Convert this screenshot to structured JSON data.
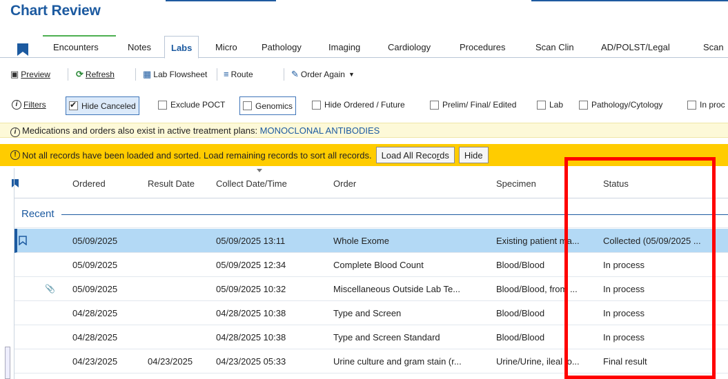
{
  "title": "Chart Review",
  "tabs": [
    {
      "label": "Encounters",
      "active": false
    },
    {
      "label": "Notes",
      "active": false
    },
    {
      "label": "Labs",
      "active": true
    },
    {
      "label": "Micro",
      "active": false
    },
    {
      "label": "Pathology",
      "active": false
    },
    {
      "label": "Imaging",
      "active": false
    },
    {
      "label": "Cardiology",
      "active": false
    },
    {
      "label": "Procedures",
      "active": false
    },
    {
      "label": "Scan Clin",
      "active": false
    },
    {
      "label": "AD/POLST/Legal",
      "active": false
    },
    {
      "label": "Scan",
      "active": false
    }
  ],
  "toolbar": {
    "preview": "Preview",
    "refresh": "Refresh",
    "flowsheet": "Lab Flowsheet",
    "route": "Route",
    "order_again": "Order Again"
  },
  "filters": {
    "label": "Filters",
    "items": [
      {
        "label": "Hide Canceled",
        "checked": true
      },
      {
        "label": "Exclude POCT",
        "checked": false
      },
      {
        "label": "Genomics",
        "checked": false
      },
      {
        "label": "Hide Ordered / Future",
        "checked": false
      },
      {
        "label": "Prelim/ Final/ Edited",
        "checked": false
      },
      {
        "label": "Lab",
        "checked": false
      },
      {
        "label": "Pathology/Cytology",
        "checked": false
      },
      {
        "label": "In proc",
        "checked": false
      }
    ]
  },
  "info": {
    "text": "Medications and orders also exist in active treatment plans: ",
    "link": "MONOCLONAL ANTIBODIES"
  },
  "warning": {
    "text": "Not all records have been loaded and sorted. Load remaining records to sort all records.",
    "load_all_prefix": "Load All Reco",
    "load_all_underline": "r",
    "load_all_suffix": "ds",
    "hide": "Hide"
  },
  "grid": {
    "columns": [
      "Ordered",
      "Result Date",
      "Collect Date/Time",
      "Order",
      "Specimen",
      "Status"
    ],
    "group": "Recent",
    "rows": [
      {
        "ordered": "05/09/2025",
        "result": "",
        "collect": "05/09/2025 13:11",
        "order": "Whole Exome",
        "specimen": "Existing patient ma...",
        "status": "Collected (05/09/2025 ...",
        "selected": true,
        "attachment": false
      },
      {
        "ordered": "05/09/2025",
        "result": "",
        "collect": "05/09/2025 12:34",
        "order": "Complete Blood Count",
        "specimen": "Blood/Blood",
        "status": "In process",
        "selected": false,
        "attachment": false
      },
      {
        "ordered": "05/09/2025",
        "result": "",
        "collect": "05/09/2025 10:32",
        "order": "Miscellaneous Outside Lab Te...",
        "specimen": "Blood/Blood, from ...",
        "status": "In process",
        "selected": false,
        "attachment": true
      },
      {
        "ordered": "04/28/2025",
        "result": "",
        "collect": "04/28/2025 10:38",
        "order": "Type and Screen",
        "specimen": "Blood/Blood",
        "status": "In process",
        "selected": false,
        "attachment": false
      },
      {
        "ordered": "04/28/2025",
        "result": "",
        "collect": "04/28/2025 10:38",
        "order": "Type and Screen Standard",
        "specimen": "Blood/Blood",
        "status": "In process",
        "selected": false,
        "attachment": false
      },
      {
        "ordered": "04/23/2025",
        "result": "04/23/2025",
        "collect": "04/23/2025 05:33",
        "order": "Urine culture and gram stain (r...",
        "specimen": "Urine/Urine, ileal lo...",
        "status": "Final result",
        "selected": false,
        "attachment": false
      }
    ]
  },
  "colors": {
    "brand": "#1c5aa0",
    "warning": "#ffcc00",
    "info": "#fdf9d8",
    "selected_row": "#b3d9f5",
    "highlight": "#ff0000"
  }
}
